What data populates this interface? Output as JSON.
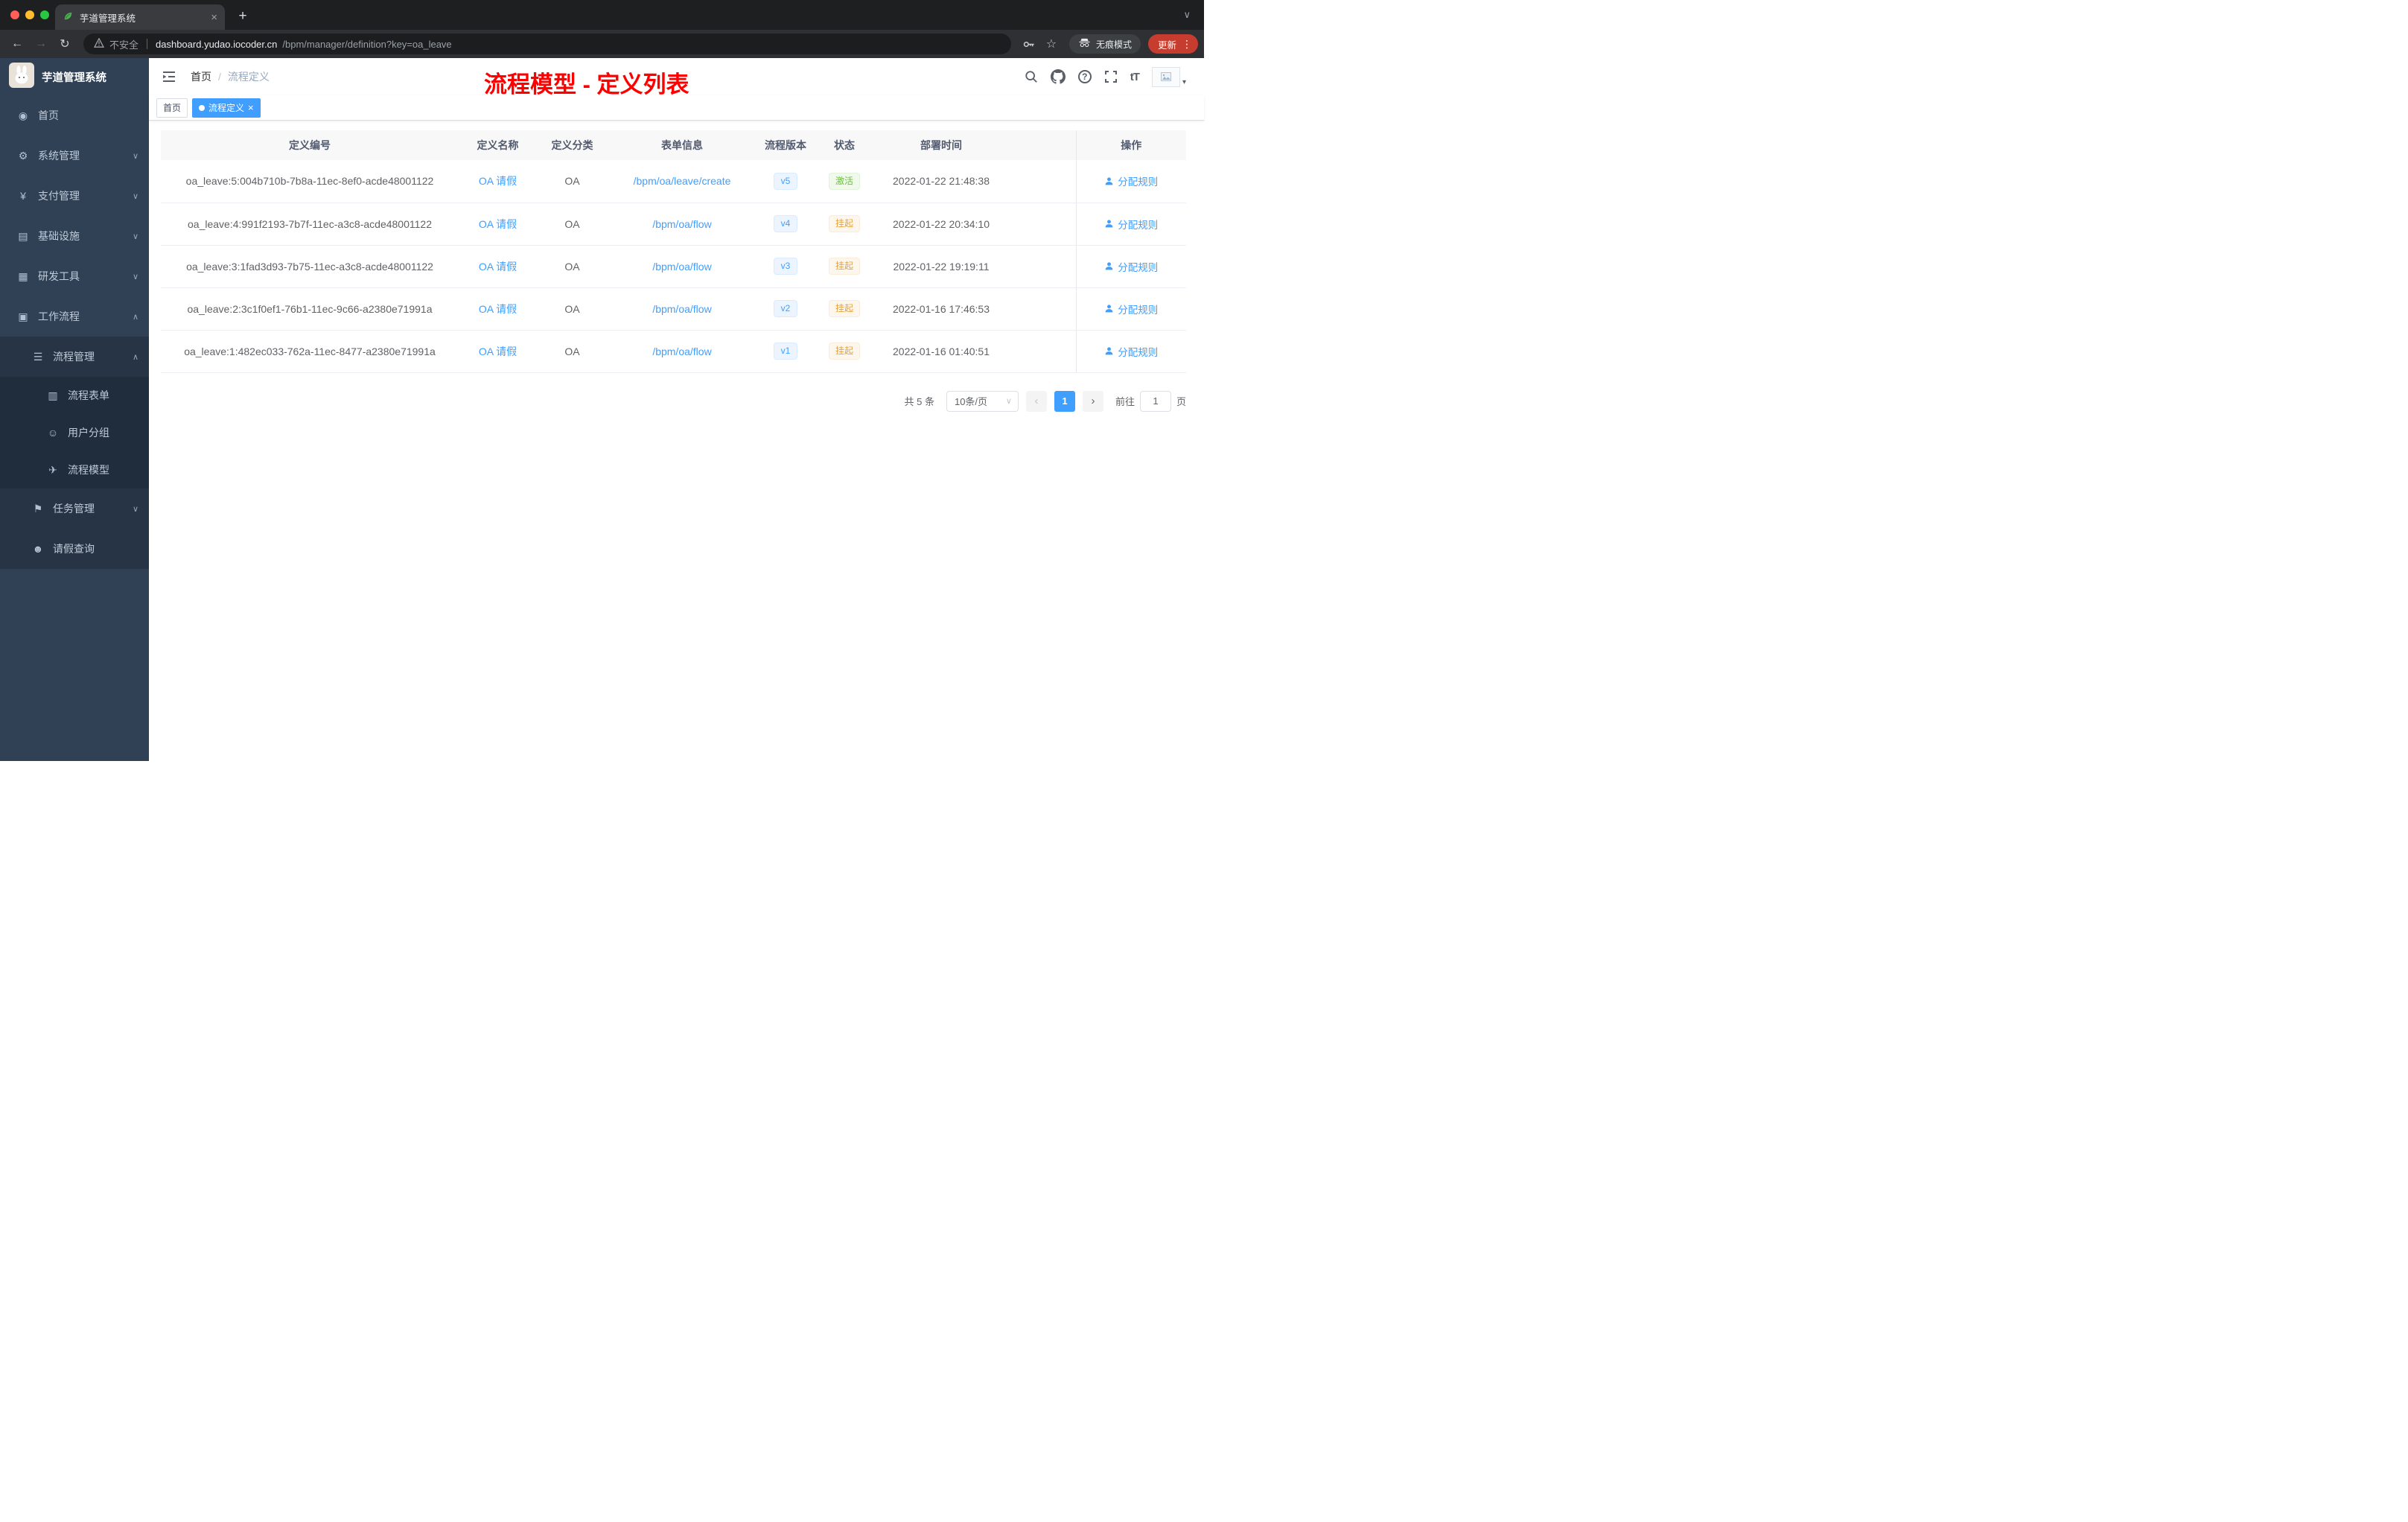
{
  "browser": {
    "tab_title": "芋道管理系统",
    "security_label": "不安全",
    "url_host": "dashboard.yudao.iocoder.cn",
    "url_path": "/bpm/manager/definition?key=oa_leave",
    "incognito_label": "无痕模式",
    "update_label": "更新"
  },
  "sidebar": {
    "logo_title": "芋道管理系统",
    "items": [
      {
        "label": "首页",
        "icon": "dashboard-icon",
        "level": "lv1"
      },
      {
        "label": "系统管理",
        "icon": "gear-icon",
        "level": "lv1",
        "chevron": "down"
      },
      {
        "label": "支付管理",
        "icon": "yen-icon",
        "level": "lv1",
        "chevron": "down"
      },
      {
        "label": "基础设施",
        "icon": "infrastructure-icon",
        "level": "lv1",
        "chevron": "down"
      },
      {
        "label": "研发工具",
        "icon": "devtools-icon",
        "level": "lv1",
        "chevron": "down"
      },
      {
        "label": "工作流程",
        "icon": "workflow-icon",
        "level": "lv1",
        "chevron": "up"
      },
      {
        "label": "流程管理",
        "icon": "process-list-icon",
        "level": "lv2",
        "chevron": "up"
      },
      {
        "label": "流程表单",
        "icon": "form-icon",
        "level": "lv3"
      },
      {
        "label": "用户分组",
        "icon": "user-group-icon",
        "level": "lv3"
      },
      {
        "label": "流程模型",
        "icon": "paper-plane-icon",
        "level": "lv3"
      },
      {
        "label": "任务管理",
        "icon": "task-flag-icon",
        "level": "lv2",
        "chevron": "down"
      },
      {
        "label": "请假查询",
        "icon": "user-icon",
        "level": "lv2"
      }
    ]
  },
  "header": {
    "breadcrumb_home": "首页",
    "breadcrumb_current": "流程定义",
    "annotation": "流程模型 - 定义列表"
  },
  "tags": [
    {
      "label": "首页",
      "state": "normal"
    },
    {
      "label": "流程定义",
      "state": "active"
    }
  ],
  "table": {
    "columns": [
      "定义编号",
      "定义名称",
      "定义分类",
      "表单信息",
      "流程版本",
      "状态",
      "部署时间",
      "操作"
    ],
    "rows": [
      {
        "id": "oa_leave:5:004b710b-7b8a-11ec-8ef0-acde48001122",
        "name": "OA 请假",
        "category": "OA",
        "form": "/bpm/oa/leave/create",
        "version": "v5",
        "status": "激活",
        "status_type": "success",
        "time": "2022-01-22 21:48:38",
        "action": "分配规则"
      },
      {
        "id": "oa_leave:4:991f2193-7b7f-11ec-a3c8-acde48001122",
        "name": "OA 请假",
        "category": "OA",
        "form": "/bpm/oa/flow",
        "version": "v4",
        "status": "挂起",
        "status_type": "warning",
        "time": "2022-01-22 20:34:10",
        "action": "分配规则"
      },
      {
        "id": "oa_leave:3:1fad3d93-7b75-11ec-a3c8-acde48001122",
        "name": "OA 请假",
        "category": "OA",
        "form": "/bpm/oa/flow",
        "version": "v3",
        "status": "挂起",
        "status_type": "warning",
        "time": "2022-01-22 19:19:11",
        "action": "分配规则"
      },
      {
        "id": "oa_leave:2:3c1f0ef1-76b1-11ec-9c66-a2380e71991a",
        "name": "OA 请假",
        "category": "OA",
        "form": "/bpm/oa/flow",
        "version": "v2",
        "status": "挂起",
        "status_type": "warning",
        "time": "2022-01-16 17:46:53",
        "action": "分配规则"
      },
      {
        "id": "oa_leave:1:482ec033-762a-11ec-8477-a2380e71991a",
        "name": "OA 请假",
        "category": "OA",
        "form": "/bpm/oa/flow",
        "version": "v1",
        "status": "挂起",
        "status_type": "warning",
        "time": "2022-01-16 01:40:51",
        "action": "分配规则"
      }
    ]
  },
  "pagination": {
    "total": "共 5 条",
    "page_size": "10条/页",
    "current_page": "1",
    "goto_label": "前往",
    "goto_value": "1",
    "unit_label": "页"
  },
  "colors": {
    "accent": "#409eff",
    "success": "#67c23a",
    "warning": "#e6a23c",
    "annotation_red": "#ff0000",
    "sidebar_bg": "#304156"
  }
}
